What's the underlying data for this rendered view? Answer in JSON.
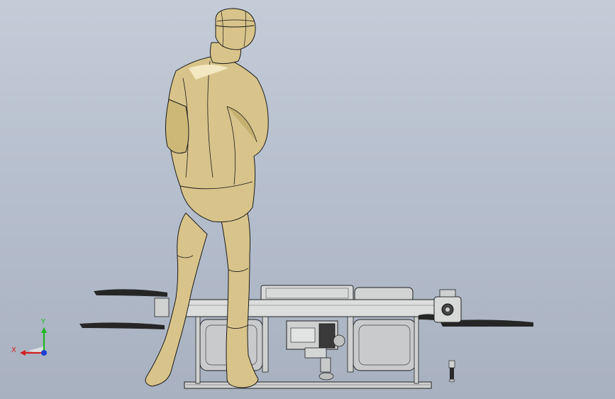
{
  "viewport": {
    "background_top": "#c4ccd8",
    "background_bottom": "#a8b1c0"
  },
  "model": {
    "figure_color": "#d8c48a",
    "figure_shadow": "#b39a58",
    "figure_highlight": "#f3e8c2",
    "metal_color": "#d6d8d8",
    "dark_part_color": "#3a3a3a",
    "edge_color": "#1a1a1a"
  },
  "triad": {
    "x_label": "X",
    "y_label": "Y",
    "x_color": "#d42020",
    "y_color": "#1db81d",
    "z_color": "#1f3fd6"
  }
}
